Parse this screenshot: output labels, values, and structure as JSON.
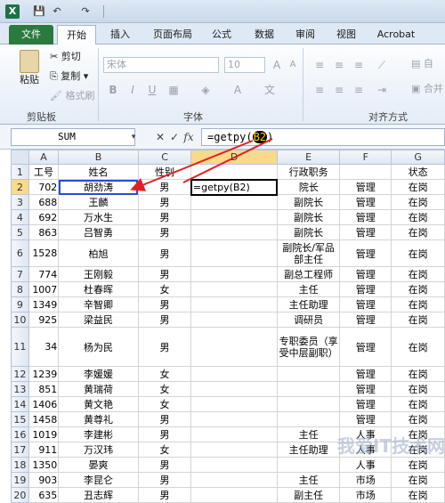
{
  "titlebar": {
    "logo": "X",
    "save": "💾",
    "undo": "↶",
    "redo": "↷"
  },
  "tabs": [
    "文件",
    "开始",
    "插入",
    "页面布局",
    "公式",
    "数据",
    "审阅",
    "视图",
    "Acrobat"
  ],
  "ribbon": {
    "paste": "粘贴",
    "cut": "剪切",
    "copy": "复制",
    "format_painter": "格式刷",
    "clipboard_group": "剪贴板",
    "font_name": "宋体",
    "font_size": "10",
    "font_group": "字体",
    "align_group": "对齐方式",
    "auto_wrap": "自",
    "merge": "合并"
  },
  "formula_bar": {
    "name_box": "SUM",
    "formula_prefix": "=getpy(",
    "formula_ref": "B2",
    "formula_suffix": ")"
  },
  "columns": [
    "A",
    "B",
    "C",
    "D",
    "E",
    "F",
    "G"
  ],
  "rows": [
    {
      "n": "1",
      "a": "工号",
      "b": "姓名",
      "c": "性别",
      "d": "",
      "e": "行政职务",
      "f": "",
      "g": "状态"
    },
    {
      "n": "2",
      "a": "702",
      "b": "胡劲涛",
      "c": "男",
      "d": "=getpy(B2)",
      "e": "院长",
      "f": "管理",
      "g": "在岗"
    },
    {
      "n": "3",
      "a": "688",
      "b": "王麟",
      "c": "男",
      "d": "",
      "e": "副院长",
      "f": "管理",
      "g": "在岗"
    },
    {
      "n": "4",
      "a": "692",
      "b": "万水生",
      "c": "男",
      "d": "",
      "e": "副院长",
      "f": "管理",
      "g": "在岗"
    },
    {
      "n": "5",
      "a": "863",
      "b": "吕智勇",
      "c": "男",
      "d": "",
      "e": "副院长",
      "f": "管理",
      "g": "在岗"
    },
    {
      "n": "6",
      "a": "1528",
      "b": "柏旭",
      "c": "男",
      "d": "",
      "e": "副院长/军品部主任",
      "f": "管理",
      "g": "在岗"
    },
    {
      "n": "7",
      "a": "774",
      "b": "王刚毅",
      "c": "男",
      "d": "",
      "e": "副总工程师",
      "f": "管理",
      "g": "在岗"
    },
    {
      "n": "8",
      "a": "1007",
      "b": "杜春晖",
      "c": "女",
      "d": "",
      "e": "主任",
      "f": "管理",
      "g": "在岗"
    },
    {
      "n": "9",
      "a": "1349",
      "b": "辛智卿",
      "c": "男",
      "d": "",
      "e": "主任助理",
      "f": "管理",
      "g": "在岗"
    },
    {
      "n": "10",
      "a": "925",
      "b": "梁益民",
      "c": "男",
      "d": "",
      "e": "调研员",
      "f": "管理",
      "g": "在岗"
    },
    {
      "n": "11",
      "a": "34",
      "b": "杨为民",
      "c": "男",
      "d": "",
      "e": "专职委员（享受中层副职）",
      "f": "管理",
      "g": "在岗"
    },
    {
      "n": "12",
      "a": "1239",
      "b": "李媛媛",
      "c": "女",
      "d": "",
      "e": "",
      "f": "管理",
      "g": "在岗"
    },
    {
      "n": "13",
      "a": "851",
      "b": "黄瑞荷",
      "c": "女",
      "d": "",
      "e": "",
      "f": "管理",
      "g": "在岗"
    },
    {
      "n": "14",
      "a": "1406",
      "b": "黄文艳",
      "c": "女",
      "d": "",
      "e": "",
      "f": "管理",
      "g": "在岗"
    },
    {
      "n": "15",
      "a": "1458",
      "b": "黄尊礼",
      "c": "男",
      "d": "",
      "e": "",
      "f": "管理",
      "g": "在岗"
    },
    {
      "n": "16",
      "a": "1019",
      "b": "李建彬",
      "c": "男",
      "d": "",
      "e": "主任",
      "f": "人事",
      "g": "在岗"
    },
    {
      "n": "17",
      "a": "911",
      "b": "万汉玮",
      "c": "女",
      "d": "",
      "e": "主任助理",
      "f": "人事",
      "g": "在岗"
    },
    {
      "n": "18",
      "a": "1350",
      "b": "晏爽",
      "c": "男",
      "d": "",
      "e": "",
      "f": "人事",
      "g": "在岗"
    },
    {
      "n": "19",
      "a": "903",
      "b": "李昆仑",
      "c": "男",
      "d": "",
      "e": "主任",
      "f": "市场",
      "g": "在岗"
    },
    {
      "n": "20",
      "a": "635",
      "b": "丑志辉",
      "c": "男",
      "d": "",
      "e": "副主任",
      "f": "市场",
      "g": "在岗"
    }
  ],
  "watermark": "我爱IT技术网",
  "colors": {
    "accent": "#2a7a3e",
    "arrow": "#e02020",
    "ref_border": "#1f4fd8"
  }
}
